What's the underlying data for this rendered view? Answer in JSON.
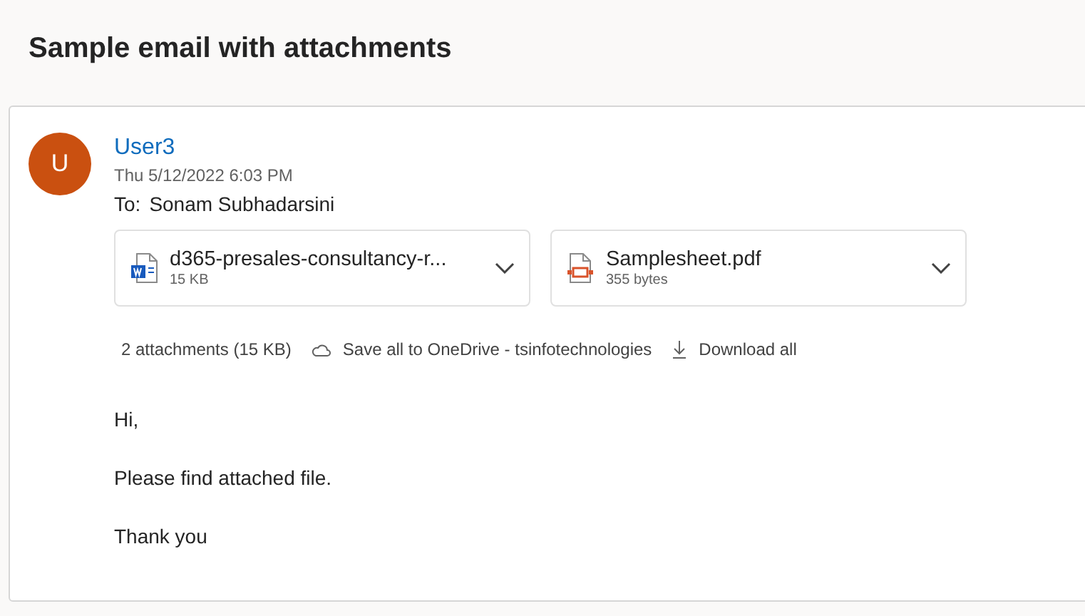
{
  "subject": "Sample email with attachments",
  "message": {
    "avatar_initial": "U",
    "sender": "User3",
    "date": "Thu 5/12/2022 6:03 PM",
    "to_label": "To:",
    "to": "Sonam Subhadarsini",
    "attachments": [
      {
        "kind": "word",
        "name": "d365-presales-consultancy-r...",
        "size": "15 KB"
      },
      {
        "kind": "pdf",
        "name": "Samplesheet.pdf",
        "size": "355 bytes"
      }
    ],
    "attachment_summary": "2 attachments (15 KB)",
    "actions": [
      {
        "kind": "cloud",
        "label": "Save all to OneDrive - tsinfotechnologies"
      },
      {
        "kind": "download",
        "label": "Download all"
      }
    ],
    "body": [
      "Hi,",
      "Please find attached file.",
      "Thank you"
    ]
  }
}
